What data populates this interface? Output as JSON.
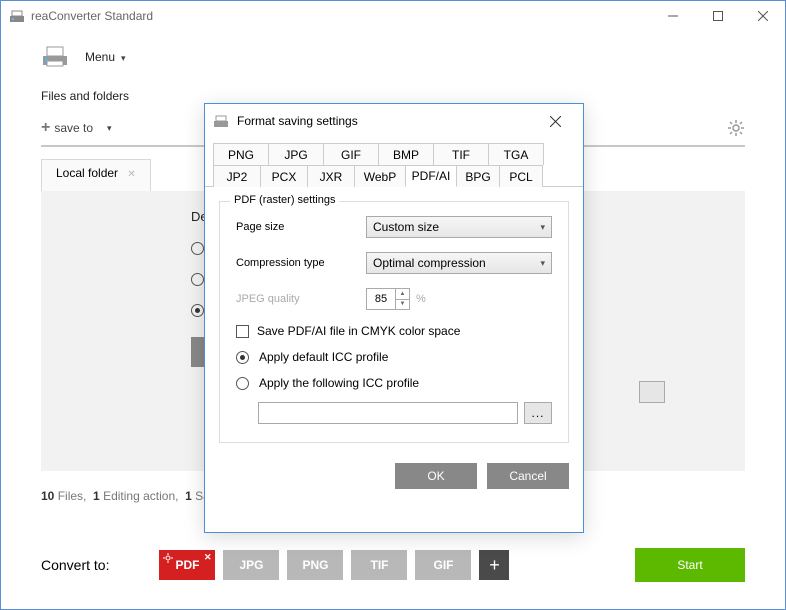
{
  "app": {
    "title": "reaConverter Standard",
    "menu_label": "Menu"
  },
  "header": {
    "label": "Files and folders"
  },
  "toolbar": {
    "saveto_label": "save to"
  },
  "tabs": [
    {
      "label": "Local folder"
    }
  ],
  "destination": {
    "label_prefix": "Des"
  },
  "status": {
    "files_count": "10",
    "files_word": "Files,",
    "actions_count": "1",
    "actions_word": "Editing action,",
    "paths_count": "1",
    "paths_word": "Saving path"
  },
  "convert": {
    "label": "Convert to:",
    "formats": [
      "PDF",
      "JPG",
      "PNG",
      "TIF",
      "GIF"
    ],
    "start": "Start"
  },
  "modal": {
    "title": "Format saving settings",
    "tabs_row1": [
      "PNG",
      "JPG",
      "GIF",
      "BMP",
      "TIF",
      "TGA"
    ],
    "tabs_row2": [
      "JP2",
      "PCX",
      "JXR",
      "WebP",
      "PDF/AI",
      "BPG",
      "PCL"
    ],
    "active_tab": "PDF/AI",
    "fieldset_legend": "PDF (raster) settings",
    "page_size_label": "Page size",
    "page_size_value": "Custom size",
    "compression_label": "Compression type",
    "compression_value": "Optimal compression",
    "jpeg_label": "JPEG quality",
    "jpeg_value": "85",
    "jpeg_unit": "%",
    "cmyk_label": "Save PDF/AI file in CMYK color space",
    "icc_default": "Apply default ICC profile",
    "icc_custom": "Apply the following ICC profile",
    "icc_path": "",
    "browse": "...",
    "ok": "OK",
    "cancel": "Cancel"
  }
}
